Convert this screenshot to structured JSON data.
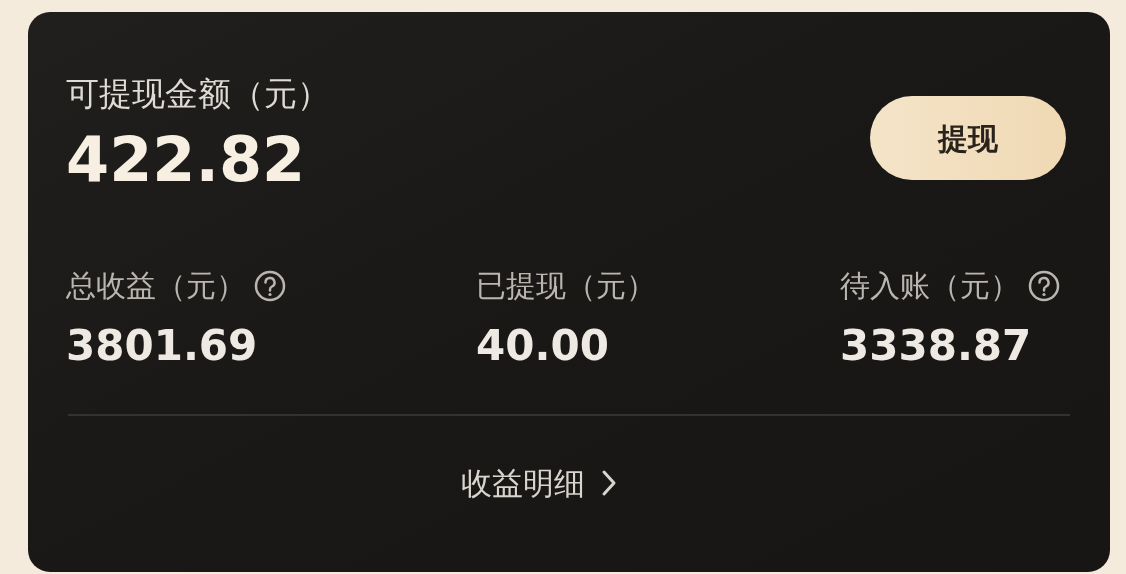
{
  "balance": {
    "label": "可提现金额（元）",
    "amount": "422.82"
  },
  "withdraw_button": {
    "label": "提现"
  },
  "stats": [
    {
      "label": "总收益（元）",
      "value": "3801.69",
      "has_help": true
    },
    {
      "label": "已提现（元）",
      "value": "40.00",
      "has_help": false
    },
    {
      "label": "待入账（元）",
      "value": "3338.87",
      "has_help": true
    }
  ],
  "details_link": {
    "label": "收益明细"
  }
}
